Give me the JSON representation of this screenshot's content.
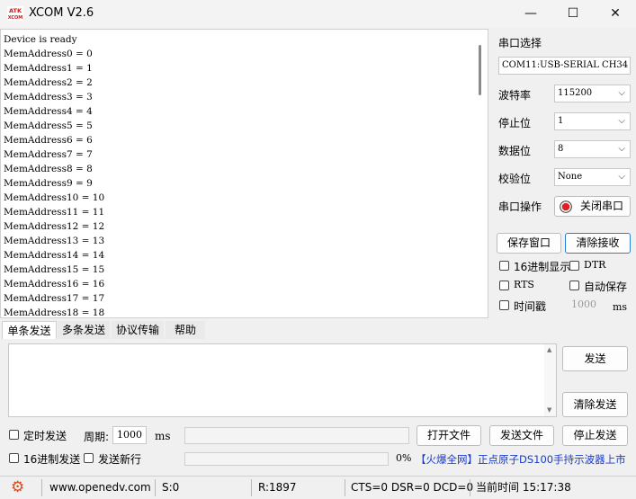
{
  "window": {
    "title": "XCOM V2.6",
    "logo_text_top": "ATK",
    "logo_text_bottom": "XCOM",
    "minimize": "—",
    "maximize": "☐",
    "close": "✕"
  },
  "receive": {
    "lines": [
      "Device is ready",
      "MemAddress0 = 0",
      "MemAddress1 = 1",
      "MemAddress2 = 2",
      "MemAddress3 = 3",
      "MemAddress4 = 4",
      "MemAddress5 = 5",
      "MemAddress6 = 6",
      "MemAddress7 = 7",
      "MemAddress8 = 8",
      "MemAddress9 = 9",
      "MemAddress10 = 10",
      "MemAddress11 = 11",
      "MemAddress12 = 12",
      "MemAddress13 = 13",
      "MemAddress14 = 14",
      "MemAddress15 = 15",
      "MemAddress16 = 16",
      "MemAddress17 = 17",
      "MemAddress18 = 18"
    ]
  },
  "serial": {
    "port_select_label": "串口选择",
    "port_value": "COM11:USB-SERIAL CH34",
    "baud_label": "波特率",
    "baud_value": "115200",
    "stop_label": "停止位",
    "stop_value": "1",
    "data_label": "数据位",
    "data_value": "8",
    "parity_label": "校验位",
    "parity_value": "None",
    "op_label": "串口操作",
    "op_button": "关闭串口",
    "save_window": "保存窗口",
    "clear_receive": "清除接收",
    "hex_display": "16进制显示",
    "dtr": "DTR",
    "rts": "RTS",
    "auto_save": "自动保存",
    "timestamp": "时间戳",
    "timestamp_value": "1000",
    "timestamp_unit": "ms",
    "indicator_color": "#e02020"
  },
  "tabs": [
    "单条发送",
    "多条发送",
    "协议传输",
    "帮助"
  ],
  "send": {
    "send_button": "发送",
    "clear_send": "清除发送",
    "timed_send": "定时发送",
    "period_label": "周期:",
    "period_value": "1000",
    "period_unit": "ms",
    "open_file": "打开文件",
    "send_file": "发送文件",
    "stop_send": "停止发送",
    "hex_send": "16进制发送",
    "send_newline": "发送新行",
    "progress_text": "0%",
    "progress_fraction": 0,
    "promo": "【火爆全网】正点原子DS100手持示波器上市"
  },
  "status": {
    "gear": "⚙",
    "url": "www.openedv.com",
    "sent": "S:0",
    "received": "R:1897",
    "lines": "CTS=0 DSR=0 DCD=0",
    "time": "当前时间 15:17:38",
    "gear_color": "#d84a1b",
    "promo_color": "#1a3cc8"
  }
}
